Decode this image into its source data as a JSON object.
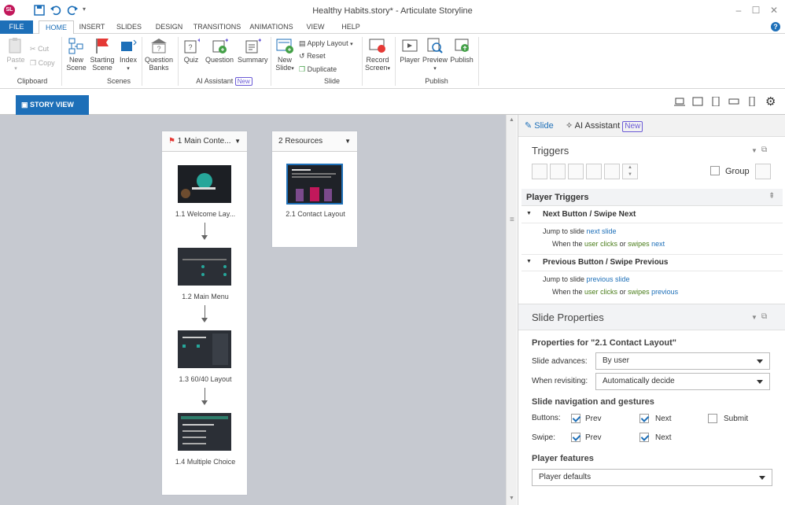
{
  "window": {
    "title": "Healthy Habits.story* - Articulate Storyline",
    "app_initials": "SL"
  },
  "tabs": [
    "FILE",
    "HOME",
    "INSERT",
    "SLIDES",
    "DESIGN",
    "TRANSITIONS",
    "ANIMATIONS",
    "VIEW",
    "HELP"
  ],
  "ribbon": {
    "clipboard": {
      "paste": "Paste",
      "cut": "Cut",
      "copy": "Copy",
      "group": "Clipboard"
    },
    "scenes": {
      "new_scene": [
        "New",
        "Scene"
      ],
      "starting_scene": [
        "Starting",
        "Scene"
      ],
      "index": "Index",
      "group": "Scenes"
    },
    "question_banks": [
      "Question",
      "Banks"
    ],
    "ai": {
      "quiz": "Quiz",
      "question": "Question",
      "summary": "Summary",
      "group": "AI Assistant",
      "badge": "New"
    },
    "slide": {
      "new_slide": [
        "New",
        "Slide"
      ],
      "apply_layout": "Apply Layout",
      "reset": "Reset",
      "duplicate": "Duplicate",
      "group": "Slide"
    },
    "record": [
      "Record",
      "Screen"
    ],
    "publish": {
      "player": "Player",
      "preview": "Preview",
      "publish": "Publish",
      "group": "Publish"
    }
  },
  "viewbar": {
    "story_view": "STORY VIEW"
  },
  "scenes": [
    {
      "title": "1  Main Conte...",
      "slides": [
        "1.1 Welcome Lay...",
        "1.2 Main Menu",
        "1.3 60/40 Layout",
        "1.4 Multiple Choice"
      ]
    },
    {
      "title": "2 Resources",
      "slides": [
        "2.1 Contact Layout"
      ]
    }
  ],
  "panel": {
    "tab_slide": "Slide",
    "tab_ai": "AI Assistant",
    "tab_ai_badge": "New",
    "triggers": {
      "title": "Triggers",
      "group": "Group"
    },
    "player_triggers": {
      "title": "Player Triggers",
      "items": [
        {
          "name": "Next Button / Swipe Next",
          "action_pre": "Jump to slide ",
          "action_link": "next slide",
          "when_pre": "When the ",
          "when_user": "user",
          "when_mid1": " ",
          "when_clicks": "clicks",
          "when_or": " or ",
          "when_swipes": "swipes",
          "when_dir": "next"
        },
        {
          "name": "Previous Button / Swipe Previous",
          "action_pre": "Jump to slide ",
          "action_link": "previous slide",
          "when_pre": "When the ",
          "when_user": "user",
          "when_mid1": " ",
          "when_clicks": "clicks",
          "when_or": " or ",
          "when_swipes": "swipes",
          "when_dir": "previous"
        }
      ]
    },
    "slide_properties": {
      "title": "Slide Properties",
      "props_for": "Properties for \"2.1 Contact Layout\"",
      "slide_advances_label": "Slide advances:",
      "slide_advances": "By user",
      "when_revisiting_label": "When revisiting:",
      "when_revisiting": "Automatically decide",
      "nav_title": "Slide navigation and gestures",
      "buttons_label": "Buttons:",
      "swipe_label": "Swipe:",
      "prev": "Prev",
      "next": "Next",
      "submit": "Submit",
      "buttons": {
        "prev": true,
        "next": true,
        "submit": false
      },
      "swipe": {
        "prev": true,
        "next": true
      },
      "player_features_title": "Player features",
      "player_features": "Player defaults"
    }
  }
}
